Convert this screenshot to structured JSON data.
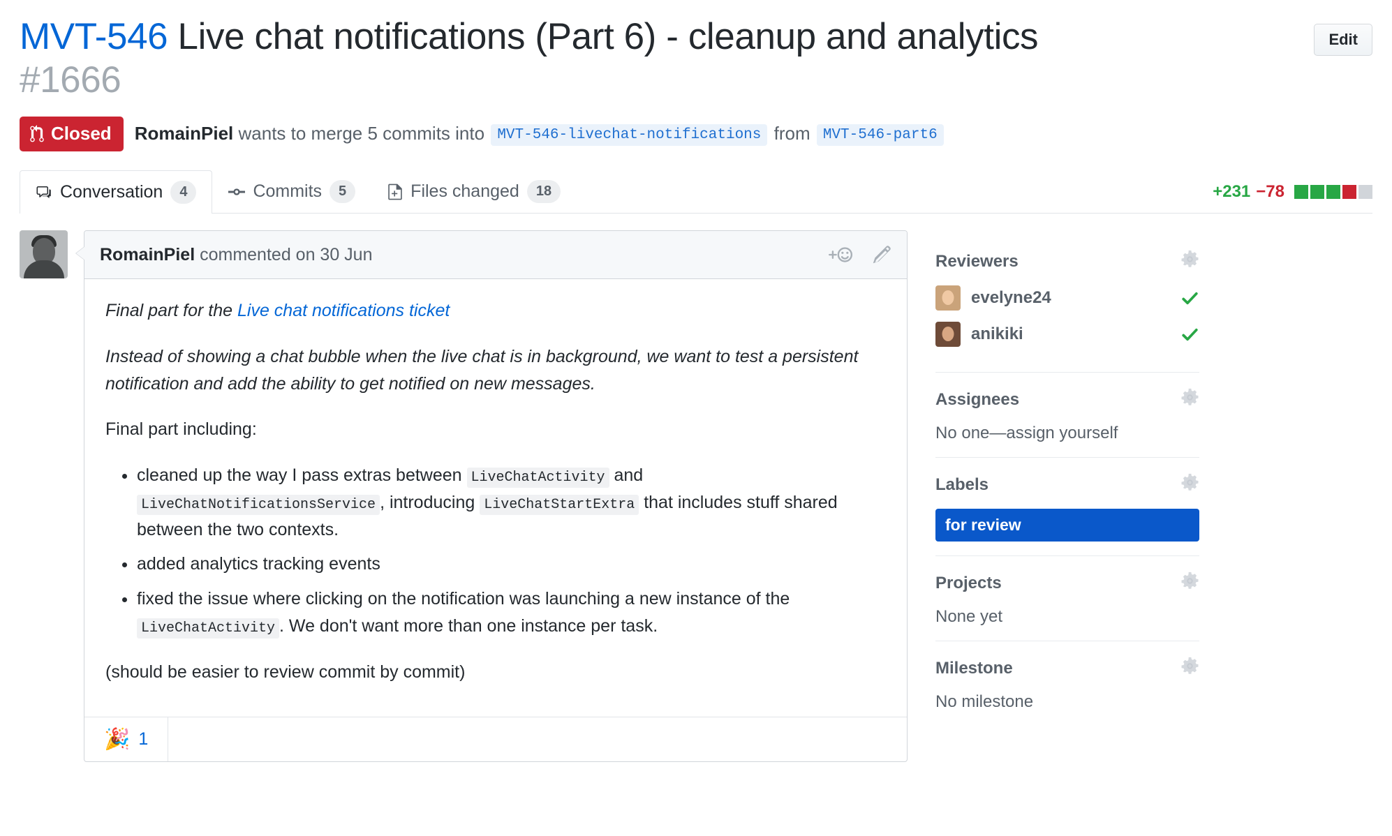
{
  "header": {
    "jira_key": "MVT-546",
    "title": " Live chat notifications (Part 6) - cleanup and analytics ",
    "number": "#1666",
    "edit_label": "Edit"
  },
  "status": {
    "state": "Closed",
    "author": "RomainPiel",
    "middle_text_1": " wants to merge 5 commits into ",
    "base_branch": "MVT-546-livechat-notifications",
    "middle_text_2": "from",
    "head_branch": "MVT-546-part6",
    "state_color": "#cb2431"
  },
  "tabs": [
    {
      "label": "Conversation",
      "count": "4",
      "icon": "comment-icon",
      "active": true
    },
    {
      "label": "Commits",
      "count": "5",
      "icon": "commit-icon",
      "active": false
    },
    {
      "label": "Files changed",
      "count": "18",
      "icon": "file-diff-icon",
      "active": false
    }
  ],
  "diffstat": {
    "additions": "+231",
    "deletions": "−78",
    "blocks": [
      "#28a745",
      "#28a745",
      "#28a745",
      "#cb2431",
      "#d1d5da"
    ]
  },
  "comment": {
    "author": "RomainPiel",
    "action": " commented on ",
    "date": "30 Jun",
    "intro_prefix": "Final part for the ",
    "intro_link": "Live chat notifications ticket",
    "paragraph_2": "Instead of showing a chat bubble when the live chat is in background, we want to test a persistent notification and add the ability to get notified on new messages.",
    "paragraph_3": "Final part including:",
    "bullets": [
      {
        "part_1": "cleaned up the way I pass extras between ",
        "code_1": "LiveChatActivity",
        "part_2": " and ",
        "code_2": "LiveChatNotificationsService",
        "part_3": ", introducing ",
        "code_3": "LiveChatStartExtra",
        "part_4": " that includes stuff shared between the two contexts."
      },
      {
        "part_1": "added analytics tracking events"
      },
      {
        "part_1": "fixed the issue where clicking on the notification was launching a new instance of the ",
        "code_1": "LiveChatActivity",
        "part_2": ". We don't want more than one instance per task."
      }
    ],
    "closing": "(should be easier to review commit by commit)",
    "reaction": {
      "emoji": "🎉",
      "count": "1"
    }
  },
  "sidebar": {
    "reviewers": {
      "title": "Reviewers",
      "people": [
        {
          "name": "evelyne24",
          "approved": true
        },
        {
          "name": "anikiki",
          "approved": true
        }
      ]
    },
    "assignees": {
      "title": "Assignees",
      "empty": "No one—assign yourself"
    },
    "labels": {
      "title": "Labels",
      "items": [
        {
          "name": "for review",
          "color": "#0a58ca"
        }
      ]
    },
    "projects": {
      "title": "Projects",
      "empty": "None yet"
    },
    "milestone": {
      "title": "Milestone",
      "empty": "No milestone"
    }
  }
}
